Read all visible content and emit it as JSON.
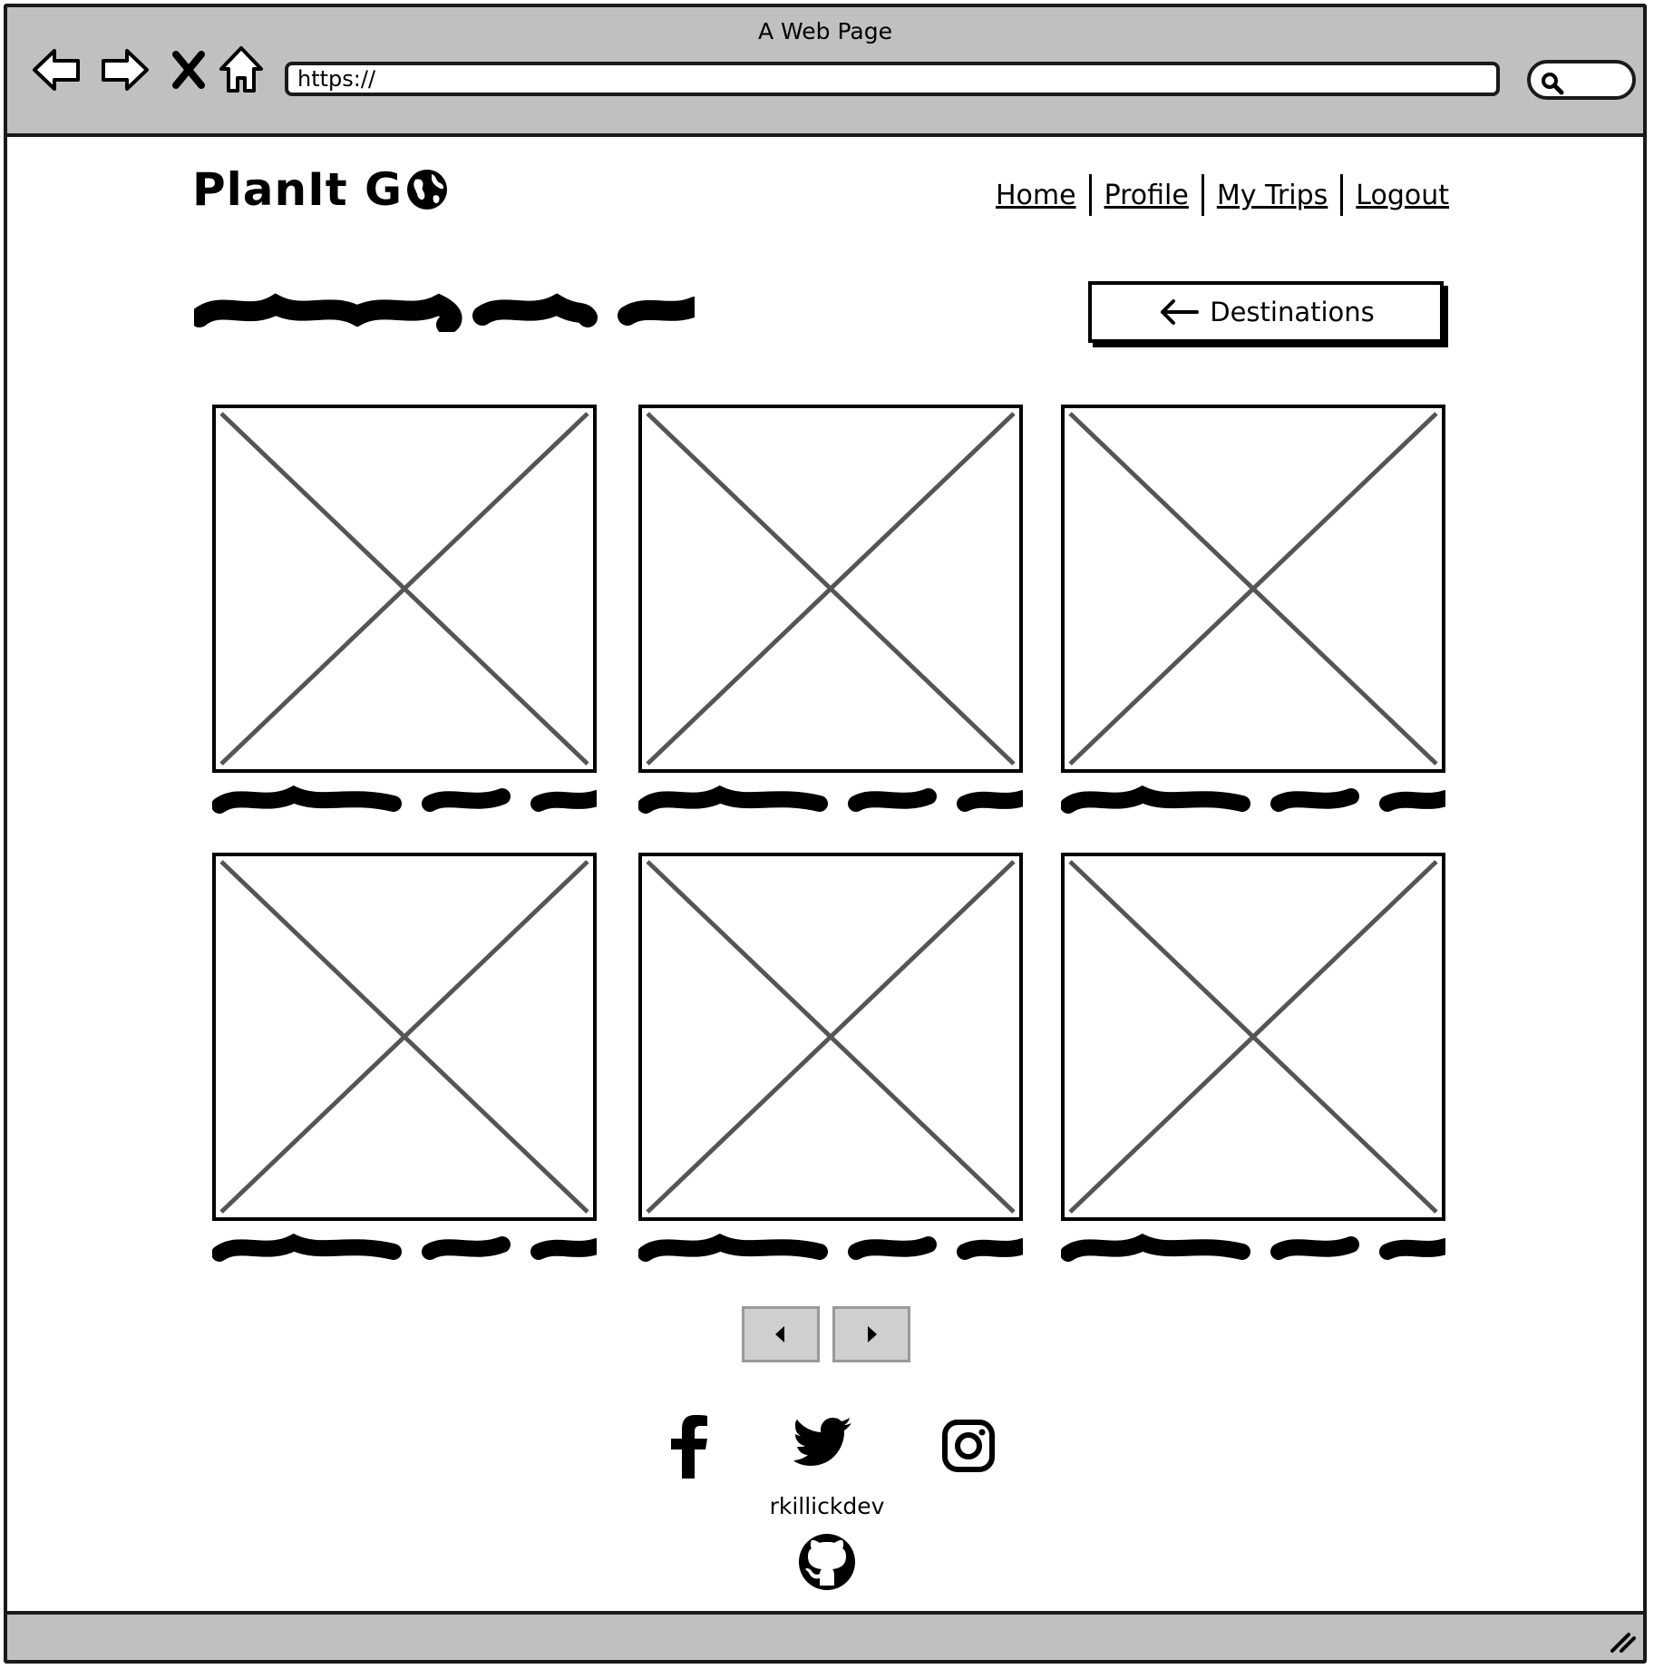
{
  "browser": {
    "title": "A Web Page",
    "url": "https://"
  },
  "site": {
    "logo_text": "PlanIt G"
  },
  "nav": {
    "items": [
      "Home",
      "Profile",
      "My Trips",
      "Logout"
    ]
  },
  "header": {
    "back_button_label": "Destinations"
  },
  "footer": {
    "handle": "rkillickdev"
  },
  "icons": {
    "back": "back-arrow-icon",
    "forward": "forward-arrow-icon",
    "stop": "stop-icon",
    "home": "home-icon",
    "search": "search-icon",
    "globe": "globe-icon",
    "facebook": "facebook-icon",
    "twitter": "twitter-icon",
    "instagram": "instagram-icon",
    "github": "github-icon"
  },
  "colors": {
    "chrome": "#c0c0c0",
    "placeholder_stroke": "#555555",
    "pager_button": "#cfcfcf"
  }
}
